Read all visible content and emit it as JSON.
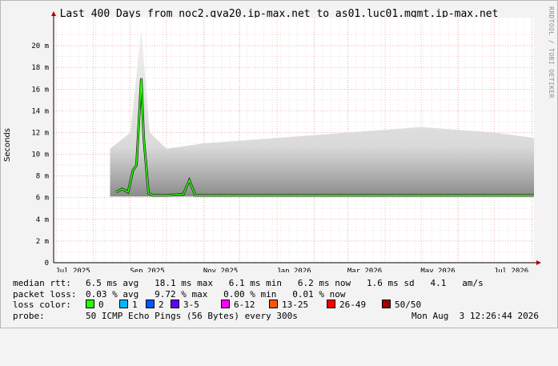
{
  "title": "Last 400 Days from noc2.gva20.ip-max.net to as01.luc01.mgmt.ip-max.net",
  "credit": "RRDTOOL / TOBI OETIKER",
  "chart_data": {
    "type": "area",
    "title": "Last 400 Days from noc2.gva20.ip-max.net to as01.luc01.mgmt.ip-max.net",
    "ylabel": "Seconds",
    "xlabel": "",
    "ylim": [
      0,
      22
    ],
    "yunit": "m",
    "yticks": [
      0,
      2,
      4,
      6,
      8,
      10,
      12,
      14,
      16,
      18,
      20
    ],
    "ytick_labels": [
      "0",
      "2 m",
      "4 m",
      "6 m",
      "8 m",
      "10 m",
      "12 m",
      "14 m",
      "16 m",
      "18 m",
      "20 m"
    ],
    "xlim": [
      "2025-06-29",
      "2026-08-03"
    ],
    "xticks": [
      "2025-07-15",
      "2025-09-15",
      "2025-11-15",
      "2026-01-15",
      "2026-03-15",
      "2026-05-15",
      "2026-07-15"
    ],
    "xtick_labels": [
      "Jul 2025",
      "Sep 2025",
      "Nov 2025",
      "Jan 2026",
      "Mar 2026",
      "May 2026",
      "Jul 2026"
    ],
    "grid": true,
    "median_series": {
      "name": "median rtt",
      "x": [
        "2025-08-20",
        "2025-08-25",
        "2025-08-30",
        "2025-09-03",
        "2025-09-06",
        "2025-09-08",
        "2025-09-10",
        "2025-09-12",
        "2025-09-14",
        "2025-09-16",
        "2025-09-20",
        "2025-10-01",
        "2025-10-15",
        "2025-10-20",
        "2025-10-25",
        "2025-11-10",
        "2025-12-15",
        "2026-01-20",
        "2026-02-20",
        "2026-03-20",
        "2026-04-20",
        "2026-05-20",
        "2026-06-20",
        "2026-07-20",
        "2026-08-03"
      ],
      "y": [
        6.5,
        6.8,
        6.5,
        8.5,
        9.0,
        13.0,
        17.0,
        11.5,
        9.0,
        6.4,
        6.2,
        6.2,
        6.3,
        7.6,
        6.2,
        6.2,
        6.2,
        6.2,
        6.2,
        6.2,
        6.2,
        6.2,
        6.2,
        6.2,
        6.2
      ]
    },
    "smoke_range": {
      "x": [
        "2025-08-15",
        "2025-09-01",
        "2025-09-10",
        "2025-09-17",
        "2025-10-01",
        "2025-11-01",
        "2026-01-01",
        "2026-03-01",
        "2026-05-01",
        "2026-07-01",
        "2026-08-03"
      ],
      "min": [
        6.1,
        6.1,
        6.1,
        6.1,
        6.1,
        6.1,
        6.1,
        6.1,
        6.1,
        6.1,
        6.1
      ],
      "max": [
        10.5,
        12.0,
        21.5,
        12.0,
        10.5,
        11.0,
        11.5,
        12.0,
        12.5,
        12.0,
        11.5
      ]
    }
  },
  "legend": {
    "median_rtt_label": "median rtt:",
    "median_rtt_values": "6.5 ms avg   18.1 ms max   6.1 ms min   6.2 ms now   1.6 ms sd   4.1   am/s",
    "packet_loss_label": "packet loss:",
    "packet_loss_values": "0.03 % avg   9.72 % max   0.00 % min   0.01 % now",
    "loss_color_label": "loss color:",
    "loss_colors": [
      {
        "label": "0",
        "color": "#26ff00"
      },
      {
        "label": "1",
        "color": "#00b8ff"
      },
      {
        "label": "2",
        "color": "#0059ff"
      },
      {
        "label": "3-5",
        "color": "#5e00ff"
      },
      {
        "label": "6-12",
        "color": "#ff00ff"
      },
      {
        "label": "13-25",
        "color": "#ff5500"
      },
      {
        "label": "26-49",
        "color": "#ff0000"
      },
      {
        "label": "50/50",
        "color": "#a10000"
      }
    ],
    "probe_label": "probe:",
    "probe_value": "50 ICMP Echo Pings (56 Bytes) every 300s",
    "timestamp": "Mon Aug  3 12:26:44 2026"
  }
}
